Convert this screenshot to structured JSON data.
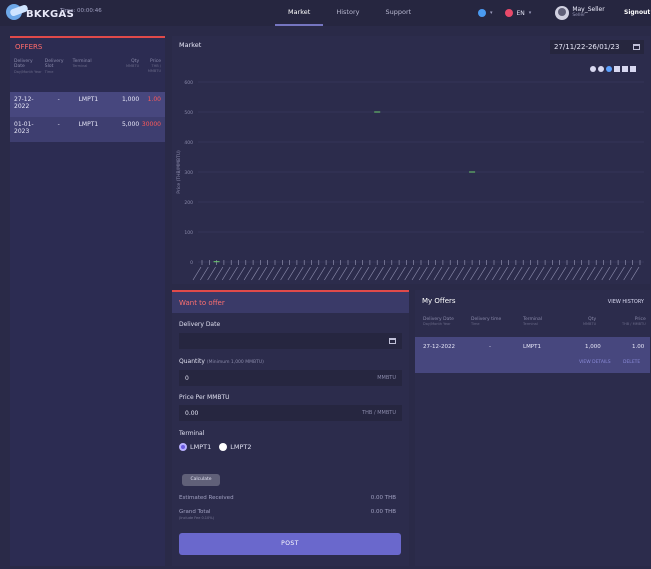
{
  "header": {
    "logo_text": "BKKGAS",
    "time": "Time: 00:00:46",
    "nav": [
      "Market",
      "History",
      "Support"
    ],
    "lang": "EN",
    "user_name": "May_Seller",
    "user_role": "Seller",
    "signout": "Signout"
  },
  "offers": {
    "title": "OFFERS",
    "columns": [
      {
        "label": "Delivery Date",
        "sub": "Day/Month Year"
      },
      {
        "label": "Delivery Slot",
        "sub": "Time"
      },
      {
        "label": "Terminal",
        "sub": "Terminal"
      },
      {
        "label": "Qty",
        "sub": "MMBTU"
      },
      {
        "label": "Price",
        "sub": "THB / MMBTU"
      }
    ],
    "rows": [
      {
        "date": "27-12-2022",
        "slot": "-",
        "terminal": "LMPT1",
        "qty": "1,000",
        "price": "1.00"
      },
      {
        "date": "01-01-2023",
        "slot": "-",
        "terminal": "LMPT1",
        "qty": "5,000",
        "price": "30000"
      }
    ]
  },
  "market": {
    "title": "Market",
    "date_range": "27/11/22-26/01/23",
    "colors": {
      "accent": "#7575c0",
      "up": "#3ab04a",
      "line": "#6ed06e"
    }
  },
  "chart_data": {
    "type": "scatter",
    "ylabel": "Price (THB/MMBTU)",
    "ylim": [
      0,
      600
    ],
    "yticks": [
      0,
      100,
      200,
      300,
      400,
      500,
      600
    ],
    "series": [
      {
        "x": [
          2,
          24,
          37
        ],
        "values": [
          1,
          500,
          300
        ]
      }
    ],
    "n_categories": 61
  },
  "form": {
    "title": "Want to offer",
    "delivery_label": "Delivery Date",
    "quantity_label": "Quantity",
    "quantity_hint": "(Minimum 1,000 MMBTU)",
    "quantity_value": "0",
    "quantity_unit": "MMBTU",
    "price_label": "Price Per MMBTU",
    "price_value": "0.00",
    "price_unit": "THB / MMBTU",
    "terminal_label": "Terminal",
    "terminal_options": [
      "LMPT1",
      "LMPT2"
    ],
    "terminal_selected": "LMPT1",
    "calc_label": "Calculate",
    "estimated_label": "Estimated Received",
    "estimated_value": "0.00",
    "estimated_unit": "THB",
    "grand_label": "Grand Total",
    "grand_sub": "(Include Fee 0.10%)",
    "grand_value": "0.00",
    "grand_unit": "THB",
    "post_label": "POST"
  },
  "my_offers": {
    "title": "My Offers",
    "view_history": "VIEW HISTORY",
    "columns": [
      {
        "label": "Delivery Date",
        "sub": "Day/Month Year"
      },
      {
        "label": "Delivery time",
        "sub": "Time"
      },
      {
        "label": "Terminal",
        "sub": "Terminal"
      },
      {
        "label": "Qty",
        "sub": "MMBTU"
      },
      {
        "label": "Price",
        "sub": "THB / MMBTU"
      }
    ],
    "row": {
      "date": "27-12-2022",
      "time": "-",
      "terminal": "LMPT1",
      "qty": "1,000",
      "price": "1.00"
    },
    "view_details": "VIEW DETAILS",
    "delete": "DELETE"
  }
}
